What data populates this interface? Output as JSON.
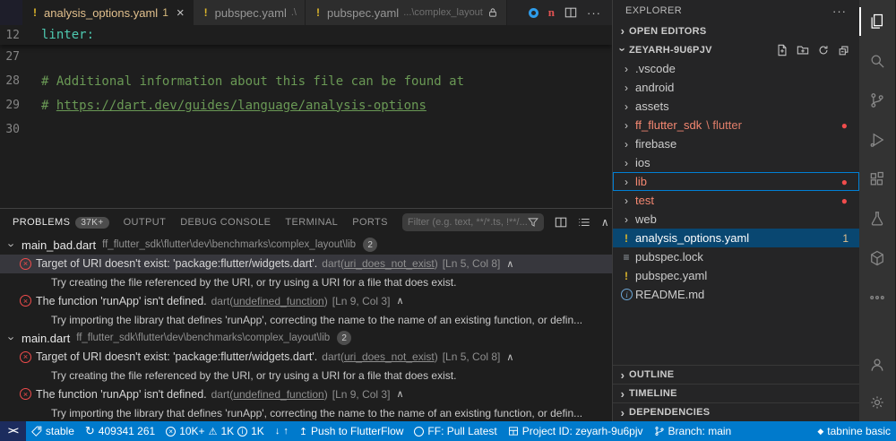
{
  "tabbar": {
    "tabs": [
      {
        "icon": "!",
        "label": "analysis_options.yaml",
        "badge": "1"
      },
      {
        "icon": "!",
        "label": "pubspec.yaml",
        "desc": ".\\"
      },
      {
        "icon": "!",
        "label": "pubspec.yaml",
        "desc": "...\\complex_layout"
      }
    ]
  },
  "editor": {
    "sticky": {
      "num": "12",
      "text": "linter:"
    },
    "lines": [
      {
        "num": "27",
        "text": ""
      },
      {
        "num": "28",
        "text": "# Additional information about this file can be found at"
      },
      {
        "num": "29",
        "prefix": "# ",
        "link": "https://dart.dev/guides/language/analysis-options"
      },
      {
        "num": "30",
        "text": ""
      }
    ]
  },
  "panel": {
    "tabs": [
      {
        "label": "PROBLEMS",
        "badge": "37K+"
      },
      {
        "label": "OUTPUT"
      },
      {
        "label": "DEBUG CONSOLE"
      },
      {
        "label": "TERMINAL"
      },
      {
        "label": "PORTS"
      }
    ],
    "filter_placeholder": "Filter (e.g. text, **/*.ts, !**/...",
    "groups": [
      {
        "file": "main_bad.dart",
        "path": "ff_flutter_sdk\\flutter\\dev\\benchmarks\\complex_layout\\lib",
        "count": "2",
        "problems": [
          {
            "message": "Target of URI doesn't exist: 'package:flutter/widgets.dart'.",
            "source_prefix": "dart(",
            "source_link": "uri_does_not_exist",
            "source_suffix": ")",
            "position": "[Ln 5, Col 8]",
            "hint": "Try creating the file referenced by the URI, or try using a URI for a file that does exist."
          },
          {
            "message": "The function 'runApp' isn't defined.",
            "source_prefix": "dart(",
            "source_link": "undefined_function",
            "source_suffix": ")",
            "position": "[Ln 9, Col 3]",
            "hint": "Try importing the library that defines 'runApp', correcting the name to the name of an existing function, or defin..."
          }
        ]
      },
      {
        "file": "main.dart",
        "path": "ff_flutter_sdk\\flutter\\dev\\benchmarks\\complex_layout\\lib",
        "count": "2",
        "problems": [
          {
            "message": "Target of URI doesn't exist: 'package:flutter/widgets.dart'.",
            "source_prefix": "dart(",
            "source_link": "uri_does_not_exist",
            "source_suffix": ")",
            "position": "[Ln 5, Col 8]",
            "hint": "Try creating the file referenced by the URI, or try using a URI for a file that does exist."
          },
          {
            "message": "The function 'runApp' isn't defined.",
            "source_prefix": "dart(",
            "source_link": "undefined_function",
            "source_suffix": ")",
            "position": "[Ln 9, Col 3]",
            "hint": "Try importing the library that defines 'runApp', correcting the name to the name of an existing function, or defin..."
          }
        ]
      }
    ]
  },
  "explorer": {
    "title": "EXPLORER",
    "open_editors": "OPEN EDITORS",
    "root": "ZEYARH-9U6PJV",
    "files": [
      {
        "name": ".vscode",
        "kind": "folder"
      },
      {
        "name": "android",
        "kind": "folder"
      },
      {
        "name": "assets",
        "kind": "folder"
      },
      {
        "name": "ff_flutter_sdk",
        "suffix": "\\ flutter",
        "kind": "folder"
      },
      {
        "name": "firebase",
        "kind": "folder"
      },
      {
        "name": "ios",
        "kind": "folder"
      },
      {
        "name": "lib",
        "kind": "folder"
      },
      {
        "name": "test",
        "kind": "folder"
      },
      {
        "name": "web",
        "kind": "folder"
      },
      {
        "name": "analysis_options.yaml",
        "kind": "file",
        "icon": "!",
        "badge": "1"
      },
      {
        "name": "pubspec.lock",
        "kind": "file",
        "icon": "≡"
      },
      {
        "name": "pubspec.yaml",
        "kind": "file",
        "icon": "!"
      },
      {
        "name": "README.md",
        "kind": "file",
        "icon": "i"
      }
    ],
    "bottom_sections": [
      "OUTLINE",
      "TIMELINE",
      "DEPENDENCIES"
    ]
  },
  "statusbar": {
    "remote": "><",
    "stable": "stable",
    "sync": "409341 261",
    "errors": "10K+",
    "warnings": "1K",
    "infos": "1K",
    "push": "Push to FlutterFlow",
    "pull": "FF: Pull Latest",
    "project": "Project ID: zeyarh-9u6pjv",
    "branch": "Branch: main",
    "tabnine": "tabnine basic"
  },
  "colors": {
    "statusbar": "#007acc",
    "selection": "#094771",
    "error": "#f14c4c",
    "warning_file": "#e2c08d",
    "comment_green": "#6a9955",
    "yaml_key_teal": "#4ec9b0"
  }
}
